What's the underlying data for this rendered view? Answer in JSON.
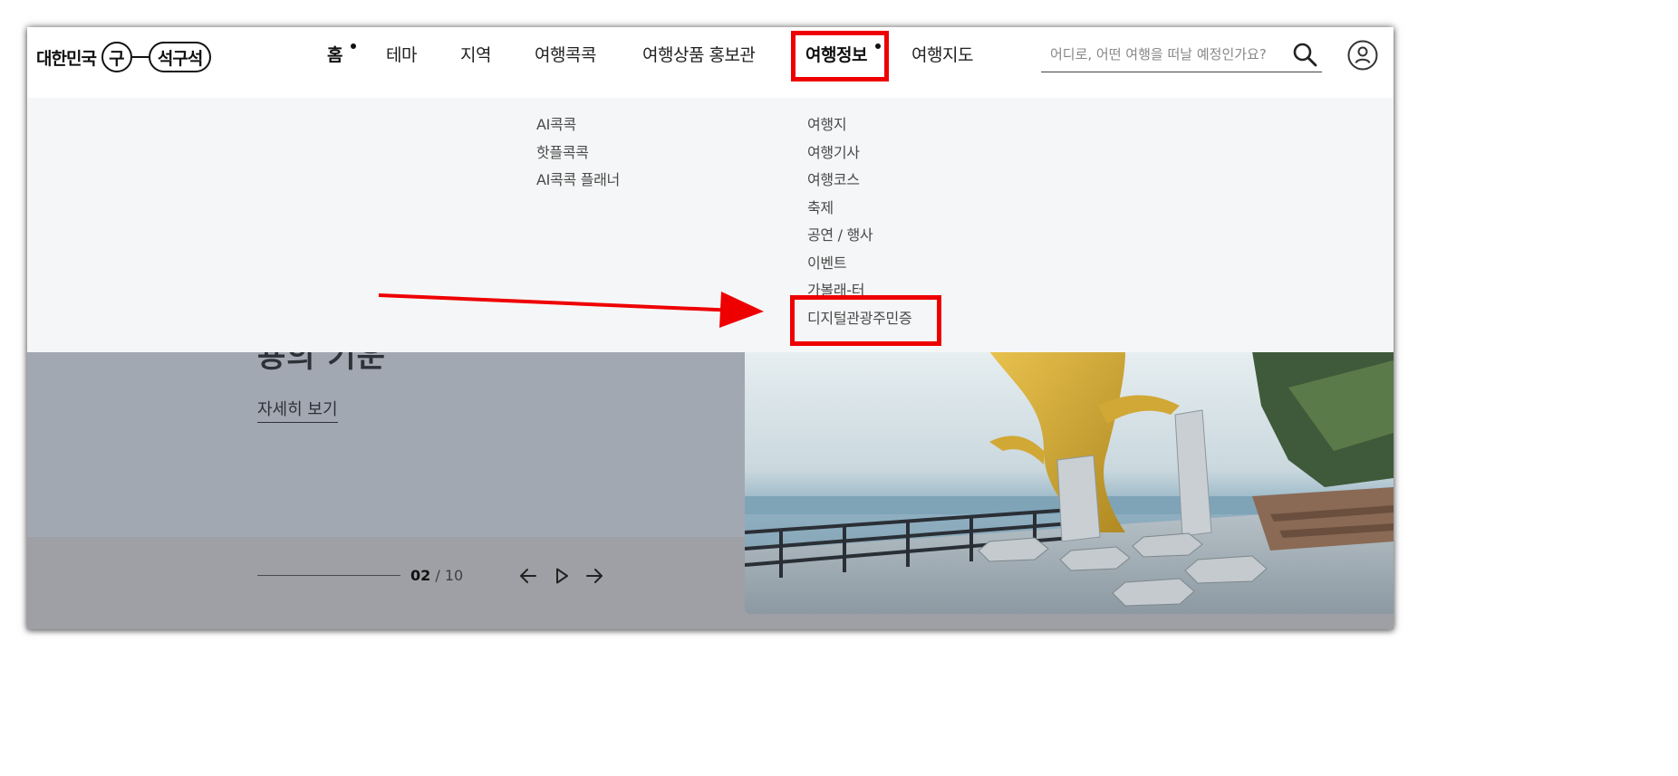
{
  "logo": {
    "text": "대한민국",
    "circle": "구",
    "pill": "석구석"
  },
  "nav": {
    "items": [
      {
        "label": "홈",
        "has_dot": true
      },
      {
        "label": "테마"
      },
      {
        "label": "지역"
      },
      {
        "label": "여행콕콕"
      },
      {
        "label": "여행상품 홍보관"
      },
      {
        "label": "여행정보",
        "has_dot": true,
        "active": true
      },
      {
        "label": "여행지도"
      }
    ]
  },
  "search": {
    "placeholder": "어디로, 어떤 여행을 떠날 예정인가요?",
    "icon": "search-icon"
  },
  "user": {
    "icon": "user-icon"
  },
  "dropdown": {
    "col1": [
      "AI콕콕",
      "핫플콕콕",
      "AI콕콕 플래너"
    ],
    "col2": [
      "여행지",
      "여행기사",
      "여행코스",
      "축제",
      "공연 / 행사",
      "이벤트",
      "가볼래-터",
      "디지털관광주민증"
    ]
  },
  "hero": {
    "title": "용의 기운",
    "link": "자세히 보기",
    "current_page": "02",
    "separator": "/",
    "total_pages": "10"
  },
  "colors": {
    "highlight": "#ee0000",
    "dropdown_bg": "#f5f6f7",
    "hero_bg": "#a2a8b2"
  }
}
